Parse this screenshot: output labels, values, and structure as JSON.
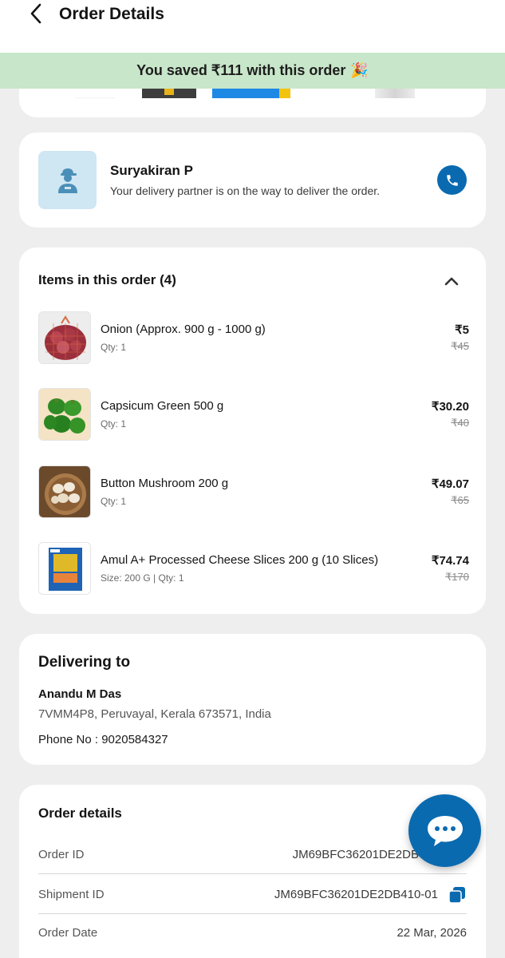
{
  "header": {
    "title": "Order Details",
    "back_icon": "chevron-left-icon"
  },
  "savings_banner": {
    "text": "You saved ₹111 with this order",
    "emoji": "🎉"
  },
  "delivery_partner": {
    "name": "Suryakiran P",
    "status": "Your delivery partner is on the way to deliver the order.",
    "avatar_icon": "delivery-person-icon",
    "call_icon": "phone-icon"
  },
  "items_section": {
    "title": "Items in this order (4)",
    "collapse_icon": "chevron-up-icon",
    "items": [
      {
        "name": "Onion (Approx. 900 g - 1000 g)",
        "meta": "Qty: 1",
        "price": "₹5",
        "mrp": "₹45",
        "image": "onion-image"
      },
      {
        "name": "Capsicum Green 500 g",
        "meta": "Qty: 1",
        "price": "₹30.20",
        "mrp": "₹40",
        "image": "capsicum-image"
      },
      {
        "name": "Button Mushroom 200 g",
        "meta": "Qty: 1",
        "price": "₹49.07",
        "mrp": "₹65",
        "image": "mushroom-image"
      },
      {
        "name": "Amul A+ Processed Cheese Slices 200 g (10 Slices)",
        "meta": "Size: 200 G | Qty: 1",
        "price": "₹74.74",
        "mrp": "₹170",
        "image": "cheese-pack-image"
      }
    ]
  },
  "delivering_to": {
    "title": "Delivering to",
    "name": "Anandu M Das",
    "address": "7VMM4P8, Peruvayal, Kerala 673571, India",
    "phone": "Phone No : 9020584327"
  },
  "order_details": {
    "title": "Order details",
    "rows": [
      {
        "label": "Order ID",
        "value": "JM69BFC36201DE2DB"
      },
      {
        "label": "Shipment ID",
        "value": "JM69BFC36201DE2DB410-01"
      },
      {
        "label": "Order Date",
        "value": "22 Mar, 2026"
      }
    ],
    "copy_icon": "copy-icon"
  },
  "chat_fab": {
    "icon": "chat-bubble-icon"
  },
  "colors": {
    "accent": "#0a6ab0",
    "banner_bg": "#c8e6c9",
    "page_bg": "#eeeeee"
  }
}
